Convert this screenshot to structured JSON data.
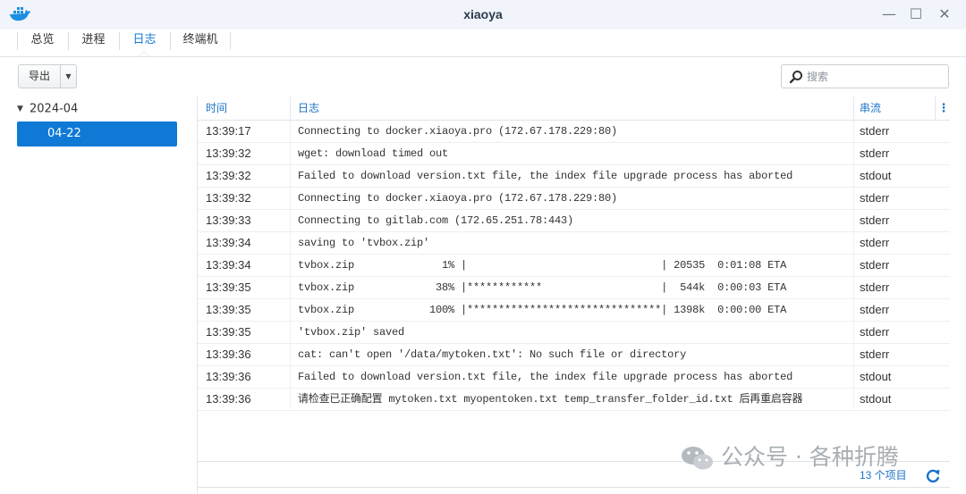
{
  "window": {
    "title": "xiaoya",
    "minimize": "—",
    "maximize": "☐",
    "close": "✕"
  },
  "tabs": [
    {
      "label": "总览",
      "active": false
    },
    {
      "label": "进程",
      "active": false
    },
    {
      "label": "日志",
      "active": true
    },
    {
      "label": "终端机",
      "active": false
    }
  ],
  "toolbar": {
    "export_label": "导出",
    "export_caret": "▼"
  },
  "search": {
    "placeholder": "搜索",
    "value": ""
  },
  "sidebar": {
    "parent": {
      "label": "2024-04",
      "toggle": "▼"
    },
    "child": {
      "label": "04-22",
      "selected": true
    }
  },
  "grid": {
    "columns": {
      "time": "时间",
      "log": "日志",
      "stream": "串流",
      "menu": "⋮"
    },
    "rows": [
      {
        "time": "13:39:17",
        "log": "Connecting to docker.xiaoya.pro (172.67.178.229:80)",
        "stream": "stderr"
      },
      {
        "time": "13:39:32",
        "log": "wget: download timed out",
        "stream": "stderr"
      },
      {
        "time": "13:39:32",
        "log": "Failed to download version.txt file, the index file upgrade process has aborted",
        "stream": "stdout"
      },
      {
        "time": "13:39:32",
        "log": "Connecting to docker.xiaoya.pro (172.67.178.229:80)",
        "stream": "stderr"
      },
      {
        "time": "13:39:33",
        "log": "Connecting to gitlab.com (172.65.251.78:443)",
        "stream": "stderr"
      },
      {
        "time": "13:39:34",
        "log": "saving to 'tvbox.zip'",
        "stream": "stderr"
      },
      {
        "time": "13:39:34",
        "log": "tvbox.zip              1% |                               | 20535  0:01:08 ETA",
        "stream": "stderr"
      },
      {
        "time": "13:39:35",
        "log": "tvbox.zip             38% |************                   |  544k  0:00:03 ETA",
        "stream": "stderr"
      },
      {
        "time": "13:39:35",
        "log": "tvbox.zip            100% |*******************************| 1398k  0:00:00 ETA",
        "stream": "stderr"
      },
      {
        "time": "13:39:35",
        "log": "'tvbox.zip' saved",
        "stream": "stderr"
      },
      {
        "time": "13:39:36",
        "log": "cat: can't open '/data/mytoken.txt': No such file or directory",
        "stream": "stderr"
      },
      {
        "time": "13:39:36",
        "log": "Failed to download version.txt file, the index file upgrade process has aborted",
        "stream": "stdout"
      },
      {
        "time": "13:39:36",
        "log": "请检查已正确配置 mytoken.txt myopentoken.txt temp_transfer_folder_id.txt 后再重启容器",
        "stream": "stdout"
      }
    ],
    "item_count": "13 个项目"
  },
  "watermark": "公众号 · 各种折腾",
  "colors": {
    "accent": "#0f7ad5",
    "header_text": "#1a73c8",
    "titlebar_bg": "#f1f5fb"
  }
}
